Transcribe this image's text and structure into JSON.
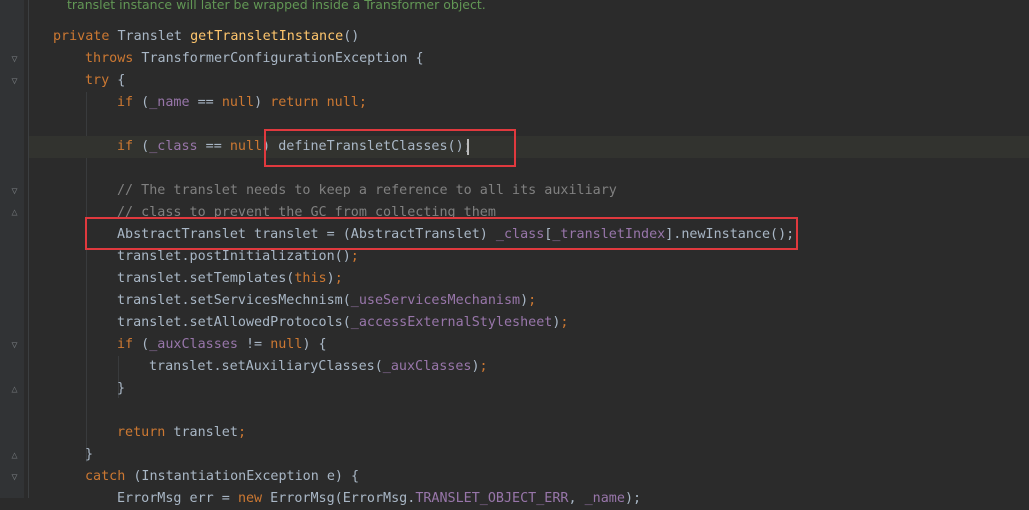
{
  "doc_comment": "translet instance will later be wrapped inside a Transformer object.",
  "code": {
    "l1": {
      "kw": "private",
      "type": " Translet ",
      "fn": "getTransletInstance",
      "rest": "()"
    },
    "l2": {
      "kw": "throws",
      "rest": " TransformerConfigurationException {"
    },
    "l3": {
      "kw": "try",
      "rest": " {"
    },
    "l4": {
      "kw1": "if",
      "a": " (",
      "f1": "_name",
      "b": " == ",
      "kw2": "null",
      "c": ") ",
      "kw3": "return",
      "d": " ",
      "kw4": "null",
      "e": ";"
    },
    "l5": {
      "kw1": "if",
      "a": " (",
      "f1": "_class",
      "b": " == ",
      "kw2": "null",
      "c": ") ",
      "call": "defineTransletClasses();"
    },
    "l6": "// The translet needs to keep a reference to all its auxiliary",
    "l7": "// class to prevent the GC from collecting them",
    "l8": {
      "a": "AbstractTranslet translet = (AbstractTranslet) ",
      "f1": "_class",
      "b": "[",
      "f2": "_transletIndex",
      "c": "].newInstance();"
    },
    "l9": {
      "a": "translet.postInitialization()",
      "e": ";"
    },
    "l10": {
      "a": "translet.setTemplates(",
      "kw": "this",
      "b": ")",
      "e": ";"
    },
    "l11": {
      "a": "translet.setServicesMechnism(",
      "f1": "_useServicesMechanism",
      "b": ")",
      "e": ";"
    },
    "l12": {
      "a": "translet.setAllowedProtocols(",
      "f1": "_accessExternalStylesheet",
      "b": ")",
      "e": ";"
    },
    "l13": {
      "kw": "if",
      "a": " (",
      "f1": "_auxClasses",
      "b": " != ",
      "kw2": "null",
      "c": ") {"
    },
    "l14": {
      "a": "translet.setAuxiliaryClasses(",
      "f1": "_auxClasses",
      "b": ")",
      "e": ";"
    },
    "l15": "}",
    "l16": {
      "kw": "return",
      "a": " translet",
      "e": ";"
    },
    "l17": "}",
    "l18": {
      "kw": "catch",
      "a": " (InstantiationException e) {"
    },
    "l19": {
      "a": "ErrorMsg err = ",
      "kw": "new",
      "b": " ErrorMsg(ErrorMsg.",
      "f1": "TRANSLET_OBJECT_ERR",
      "c": ", ",
      "f2": "_name",
      "d": ");"
    }
  }
}
